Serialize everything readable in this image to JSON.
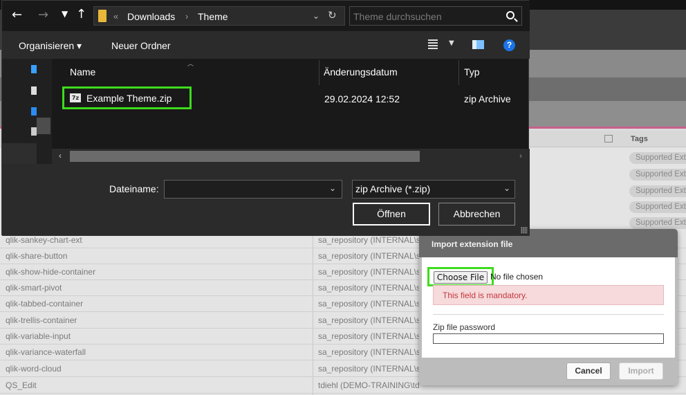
{
  "file_dialog": {
    "breadcrumb": {
      "overflow": "«",
      "items": [
        "Downloads",
        "Theme"
      ]
    },
    "search_placeholder": "Theme durchsuchen",
    "toolbar": {
      "organize": "Organisieren",
      "new_folder": "Neuer Ordner",
      "help": "?"
    },
    "columns": {
      "name": "Name",
      "date": "Änderungsdatum",
      "type": "Typ"
    },
    "files": [
      {
        "icon": "7z-archive-icon",
        "icon_label": "7z",
        "name": "Example Theme.zip",
        "date": "29.02.2024 12:52",
        "type": "zip Archive"
      }
    ],
    "filename_label": "Dateiname:",
    "filename_value": "",
    "filetype_selected": "zip Archive (*.zip)",
    "open_button": "Öffnen",
    "cancel_button": "Abbrechen"
  },
  "background_table": {
    "tags_header": "Tags",
    "tag_value": "Supported Ext",
    "rows": [
      {
        "name": "qlik-sankey-chart-ext",
        "owner": "sa_repository (INTERNAL\\sa_repository)"
      },
      {
        "name": "qlik-share-button",
        "owner": "sa_repository (INTERNAL\\sa_repository)"
      },
      {
        "name": "qlik-show-hide-container",
        "owner": "sa_repository (INTERNAL\\sa_repository)"
      },
      {
        "name": "qlik-smart-pivot",
        "owner": "sa_repository (INTERNAL\\sa_repository)"
      },
      {
        "name": "qlik-tabbed-container",
        "owner": "sa_repository (INTERNAL\\sa_repository)"
      },
      {
        "name": "qlik-trellis-container",
        "owner": "sa_repository (INTERNAL\\sa_repository)"
      },
      {
        "name": "qlik-variable-input",
        "owner": "sa_repository (INTERNAL\\sa_repository)"
      },
      {
        "name": "qlik-variance-waterfall",
        "owner": "sa_repository (INTERNAL\\sa_repository)"
      },
      {
        "name": "qlik-word-cloud",
        "owner": "sa_repository (INTERNAL\\sa_repository)"
      },
      {
        "name": "QS_Edit",
        "owner": "tdiehl (DEMO-TRAINING\\tdiehl)"
      }
    ]
  },
  "import_dialog": {
    "title": "Import extension file",
    "choose_file": "Choose File",
    "no_file": "No file chosen",
    "error": "This field is mandatory.",
    "password_label": "Zip file password",
    "password_value": "",
    "cancel": "Cancel",
    "import": "Import"
  },
  "colors": {
    "highlight": "#3ddc1c",
    "error_text": "#c4373d",
    "error_bg": "#f6dadc",
    "accent_line": "#c9608b"
  }
}
